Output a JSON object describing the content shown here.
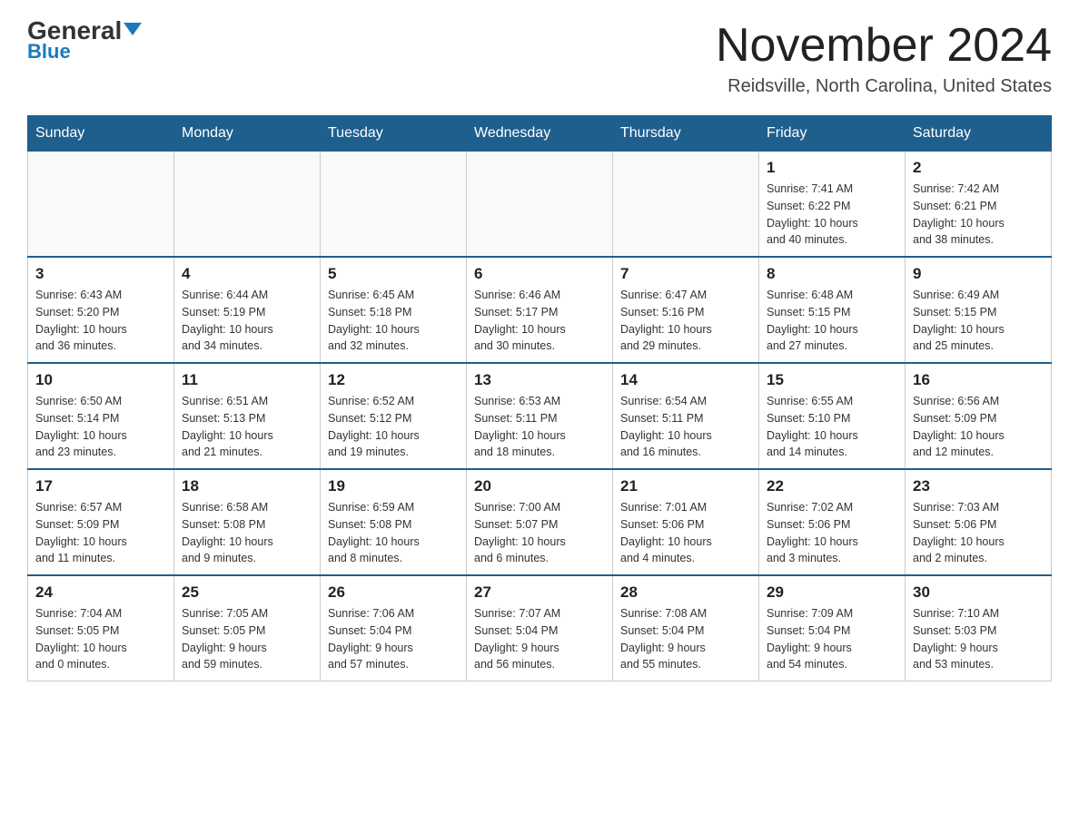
{
  "logo": {
    "text_general": "General",
    "text_blue": "Blue"
  },
  "title": {
    "month_year": "November 2024",
    "location": "Reidsville, North Carolina, United States"
  },
  "days_of_week": [
    "Sunday",
    "Monday",
    "Tuesday",
    "Wednesday",
    "Thursday",
    "Friday",
    "Saturday"
  ],
  "weeks": [
    [
      {
        "day": "",
        "info": ""
      },
      {
        "day": "",
        "info": ""
      },
      {
        "day": "",
        "info": ""
      },
      {
        "day": "",
        "info": ""
      },
      {
        "day": "",
        "info": ""
      },
      {
        "day": "1",
        "info": "Sunrise: 7:41 AM\nSunset: 6:22 PM\nDaylight: 10 hours\nand 40 minutes."
      },
      {
        "day": "2",
        "info": "Sunrise: 7:42 AM\nSunset: 6:21 PM\nDaylight: 10 hours\nand 38 minutes."
      }
    ],
    [
      {
        "day": "3",
        "info": "Sunrise: 6:43 AM\nSunset: 5:20 PM\nDaylight: 10 hours\nand 36 minutes."
      },
      {
        "day": "4",
        "info": "Sunrise: 6:44 AM\nSunset: 5:19 PM\nDaylight: 10 hours\nand 34 minutes."
      },
      {
        "day": "5",
        "info": "Sunrise: 6:45 AM\nSunset: 5:18 PM\nDaylight: 10 hours\nand 32 minutes."
      },
      {
        "day": "6",
        "info": "Sunrise: 6:46 AM\nSunset: 5:17 PM\nDaylight: 10 hours\nand 30 minutes."
      },
      {
        "day": "7",
        "info": "Sunrise: 6:47 AM\nSunset: 5:16 PM\nDaylight: 10 hours\nand 29 minutes."
      },
      {
        "day": "8",
        "info": "Sunrise: 6:48 AM\nSunset: 5:15 PM\nDaylight: 10 hours\nand 27 minutes."
      },
      {
        "day": "9",
        "info": "Sunrise: 6:49 AM\nSunset: 5:15 PM\nDaylight: 10 hours\nand 25 minutes."
      }
    ],
    [
      {
        "day": "10",
        "info": "Sunrise: 6:50 AM\nSunset: 5:14 PM\nDaylight: 10 hours\nand 23 minutes."
      },
      {
        "day": "11",
        "info": "Sunrise: 6:51 AM\nSunset: 5:13 PM\nDaylight: 10 hours\nand 21 minutes."
      },
      {
        "day": "12",
        "info": "Sunrise: 6:52 AM\nSunset: 5:12 PM\nDaylight: 10 hours\nand 19 minutes."
      },
      {
        "day": "13",
        "info": "Sunrise: 6:53 AM\nSunset: 5:11 PM\nDaylight: 10 hours\nand 18 minutes."
      },
      {
        "day": "14",
        "info": "Sunrise: 6:54 AM\nSunset: 5:11 PM\nDaylight: 10 hours\nand 16 minutes."
      },
      {
        "day": "15",
        "info": "Sunrise: 6:55 AM\nSunset: 5:10 PM\nDaylight: 10 hours\nand 14 minutes."
      },
      {
        "day": "16",
        "info": "Sunrise: 6:56 AM\nSunset: 5:09 PM\nDaylight: 10 hours\nand 12 minutes."
      }
    ],
    [
      {
        "day": "17",
        "info": "Sunrise: 6:57 AM\nSunset: 5:09 PM\nDaylight: 10 hours\nand 11 minutes."
      },
      {
        "day": "18",
        "info": "Sunrise: 6:58 AM\nSunset: 5:08 PM\nDaylight: 10 hours\nand 9 minutes."
      },
      {
        "day": "19",
        "info": "Sunrise: 6:59 AM\nSunset: 5:08 PM\nDaylight: 10 hours\nand 8 minutes."
      },
      {
        "day": "20",
        "info": "Sunrise: 7:00 AM\nSunset: 5:07 PM\nDaylight: 10 hours\nand 6 minutes."
      },
      {
        "day": "21",
        "info": "Sunrise: 7:01 AM\nSunset: 5:06 PM\nDaylight: 10 hours\nand 4 minutes."
      },
      {
        "day": "22",
        "info": "Sunrise: 7:02 AM\nSunset: 5:06 PM\nDaylight: 10 hours\nand 3 minutes."
      },
      {
        "day": "23",
        "info": "Sunrise: 7:03 AM\nSunset: 5:06 PM\nDaylight: 10 hours\nand 2 minutes."
      }
    ],
    [
      {
        "day": "24",
        "info": "Sunrise: 7:04 AM\nSunset: 5:05 PM\nDaylight: 10 hours\nand 0 minutes."
      },
      {
        "day": "25",
        "info": "Sunrise: 7:05 AM\nSunset: 5:05 PM\nDaylight: 9 hours\nand 59 minutes."
      },
      {
        "day": "26",
        "info": "Sunrise: 7:06 AM\nSunset: 5:04 PM\nDaylight: 9 hours\nand 57 minutes."
      },
      {
        "day": "27",
        "info": "Sunrise: 7:07 AM\nSunset: 5:04 PM\nDaylight: 9 hours\nand 56 minutes."
      },
      {
        "day": "28",
        "info": "Sunrise: 7:08 AM\nSunset: 5:04 PM\nDaylight: 9 hours\nand 55 minutes."
      },
      {
        "day": "29",
        "info": "Sunrise: 7:09 AM\nSunset: 5:04 PM\nDaylight: 9 hours\nand 54 minutes."
      },
      {
        "day": "30",
        "info": "Sunrise: 7:10 AM\nSunset: 5:03 PM\nDaylight: 9 hours\nand 53 minutes."
      }
    ]
  ]
}
